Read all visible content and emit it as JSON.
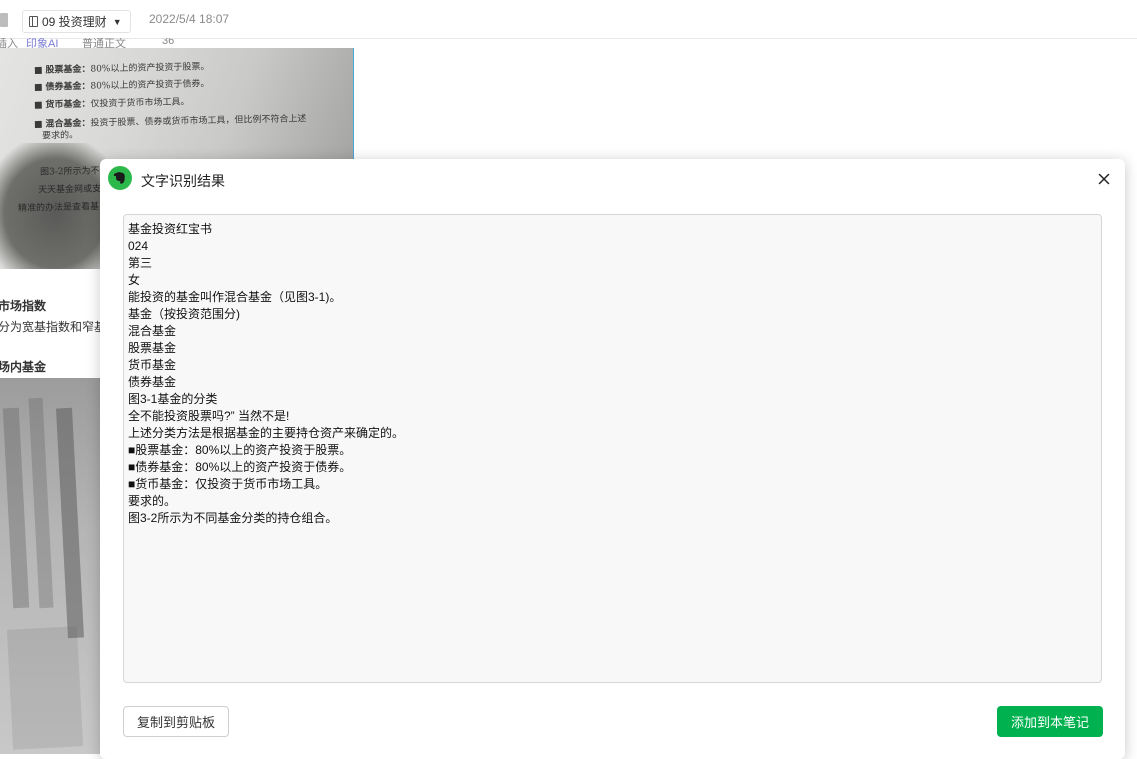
{
  "topbar": {
    "notebook_label": "09 投资理财",
    "timestamp": "2022/5/4 18:07"
  },
  "toolbar_fragments": [
    "插入",
    "印象AI",
    "普通正文",
    "36"
  ],
  "note": {
    "photo1_lines": [
      {
        "bold": "股票基金：",
        "rest": "80%以上的资产投资于股票。"
      },
      {
        "bold": "债券基金：",
        "rest": "80%以上的资产投资于债券。"
      },
      {
        "bold": "货币基金：",
        "rest": "仅投资于货币市场工具。"
      },
      {
        "bold": "混合基金：",
        "rest": "投资于股票、债券或货币市场工具，但比例不符合上述"
      },
      {
        "bold": "",
        "rest": "要求的。"
      },
      {
        "bold": "",
        "rest": "图3-2所示为不"
      },
      {
        "bold": "",
        "rest": "天天基金网或支"
      },
      {
        "bold": "",
        "rest": "精准的办法是查看基"
      }
    ],
    "heading1": "市场指数",
    "text1": "分为宽基指数和窄基",
    "heading2": "场内基金"
  },
  "dialog": {
    "title": "文字识别结果",
    "ocr_lines": [
      "基金投资红宝书",
      "024",
      "第三",
      "女",
      "能投资的基金叫作混合基金（见图3-1)。",
      "基金（按投资范围分)",
      "混合基金",
      "股票基金",
      "货币基金",
      "债券基金",
      "图3-1基金的分类",
      "全不能投资股票吗?” 当然不是!",
      "上述分类方法是根据基金的主要持仓资产来确定的。",
      "■股票基金：80%以上的资产投资于股票。",
      "■债券基金：80%以上的资产投资于债券。",
      "■货币基金：仅投资于货币市场工具。",
      "要求的。",
      "图3-2所示为不同基金分类的持仓组合。"
    ],
    "copy_label": "复制到剪贴板",
    "add_label": "添加到本笔记"
  },
  "colors": {
    "accent_green": "#00b14f",
    "logo_green": "#2db84b"
  }
}
